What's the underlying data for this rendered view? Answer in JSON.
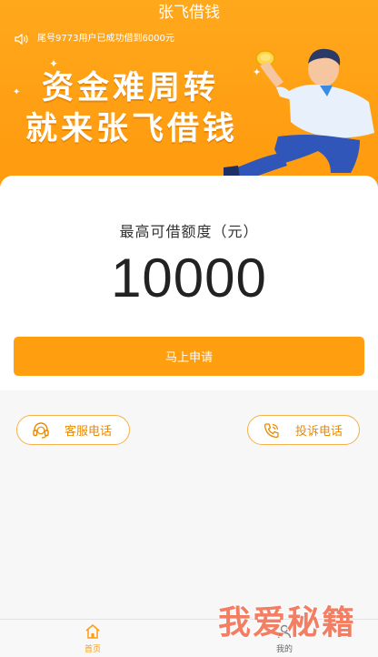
{
  "header": {
    "title": "张飞借钱",
    "notice_icon": "speaker-icon",
    "notice": "尾号9773用户已成功借到6000元",
    "slogan_line1": "资金难周转",
    "slogan_line2": "就来张飞借钱",
    "illustration": "man-holding-coins"
  },
  "quota": {
    "label": "最高可借额度（元）",
    "value": "10000"
  },
  "apply_button": "马上申请",
  "contact": {
    "service_icon": "headset-icon",
    "service_label": "客服电话",
    "complaint_icon": "phone-icon",
    "complaint_label": "投诉电话"
  },
  "tabbar": {
    "items": [
      {
        "label": "首页",
        "icon": "home-icon",
        "active": true
      },
      {
        "label": "我的",
        "icon": "user-icon",
        "active": false
      }
    ]
  },
  "watermark": "我爱秘籍",
  "colors": {
    "accent": "#ff9e0e",
    "accent_text": "#ea8a00"
  }
}
